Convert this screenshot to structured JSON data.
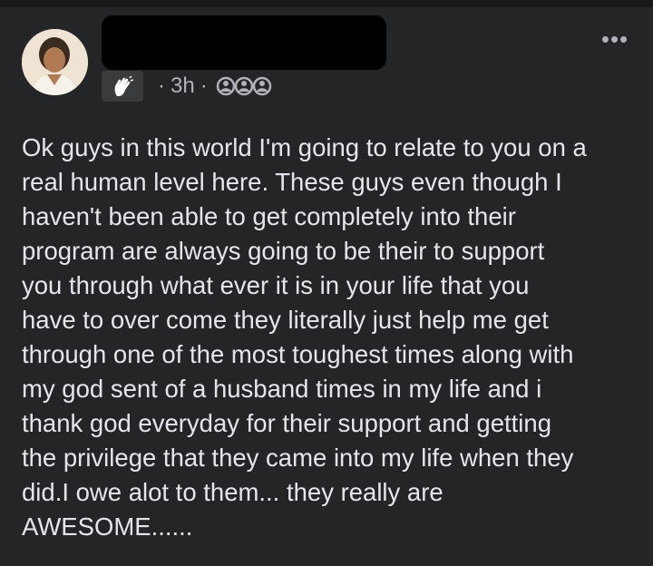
{
  "post": {
    "time": "3h",
    "separator": "·",
    "more_icon": "more-dots-icon",
    "badge_icon": "wave-hand-icon",
    "audience_icon": "group-icon",
    "text": "Ok guys in this world I'm going to relate to you on a\nreal human level here. These guys even though I\nhaven't been able to get completely into their\nprogram are always going to be their to support\nyou through what ever it is in your life that you\nhave to over come they literally just help me get\nthrough one of the most toughest times along with\nmy god sent of a husband times in my life and i\nthank god everyday for their support and getting\nthe privilege that they came into my life when they\ndid.I owe alot to them... they really are\nAWESOME......"
  }
}
